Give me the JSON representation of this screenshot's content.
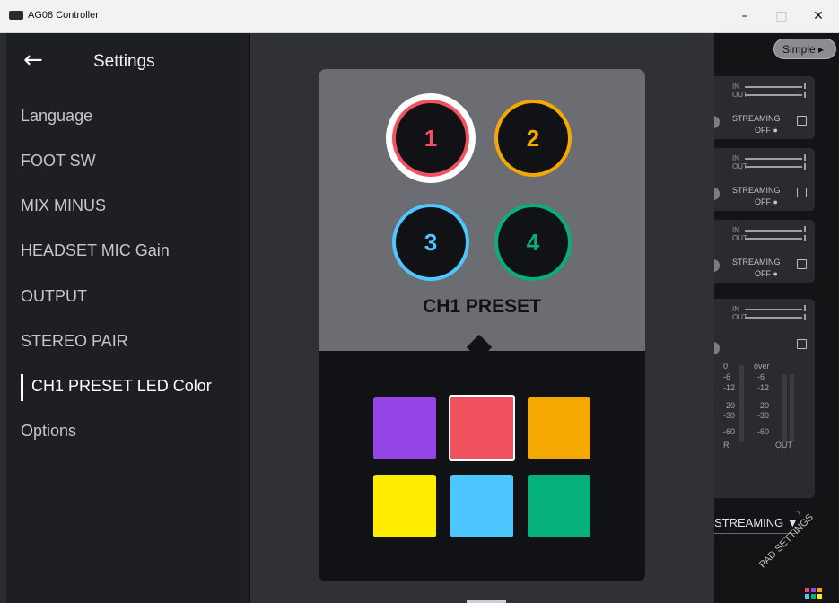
{
  "window": {
    "title": "AG08 Controller",
    "minimize": "–",
    "maximize": "□",
    "close": "✕"
  },
  "sidebar": {
    "back_icon": "←",
    "title": "Settings",
    "items": [
      {
        "label": "Language"
      },
      {
        "label": "FOOT SW"
      },
      {
        "label": "MIX MINUS"
      },
      {
        "label": "HEADSET MIC Gain"
      },
      {
        "label": "OUTPUT"
      },
      {
        "label": "STEREO PAIR"
      },
      {
        "label": "CH1 PRESET LED Color",
        "active": true
      },
      {
        "label": "Options"
      }
    ]
  },
  "popup": {
    "label": "CH1 PRESET",
    "presets": [
      {
        "number": "1",
        "color": "#f0525f",
        "selected": true
      },
      {
        "number": "2",
        "color": "#f5a800"
      },
      {
        "number": "3",
        "color": "#4cc7ff"
      },
      {
        "number": "4",
        "color": "#06b07a"
      }
    ],
    "swatches": [
      {
        "color": "#9545e6",
        "name": "purple"
      },
      {
        "color": "#f0525f",
        "name": "red",
        "selected": true
      },
      {
        "color": "#f5a800",
        "name": "orange"
      },
      {
        "color": "#ffec00",
        "name": "yellow"
      },
      {
        "color": "#4cc7ff",
        "name": "light-blue"
      },
      {
        "color": "#06b07a",
        "name": "green"
      }
    ]
  },
  "right_panel": {
    "simple_button": "Simple ▸",
    "meter_in": "IN",
    "meter_out": "OUT",
    "streaming": "STREAMING",
    "off": "OFF ●",
    "scale_left": [
      "0",
      "-6",
      "-12",
      "-20",
      "-30",
      "-60"
    ],
    "scale_right_top": "over",
    "scale_right": [
      "-6",
      "-12",
      "-20",
      "-30",
      "-60"
    ],
    "r_label": "R",
    "out_label": "OUT",
    "streaming_dropdown": "STREAMING ▼",
    "pad_settings": "PAD SETTINGS",
    "pad_colors": [
      "#e84a5f",
      "#9545e6",
      "#f5a800",
      "#4cc7ff",
      "#06b07a",
      "#ffec00"
    ]
  }
}
